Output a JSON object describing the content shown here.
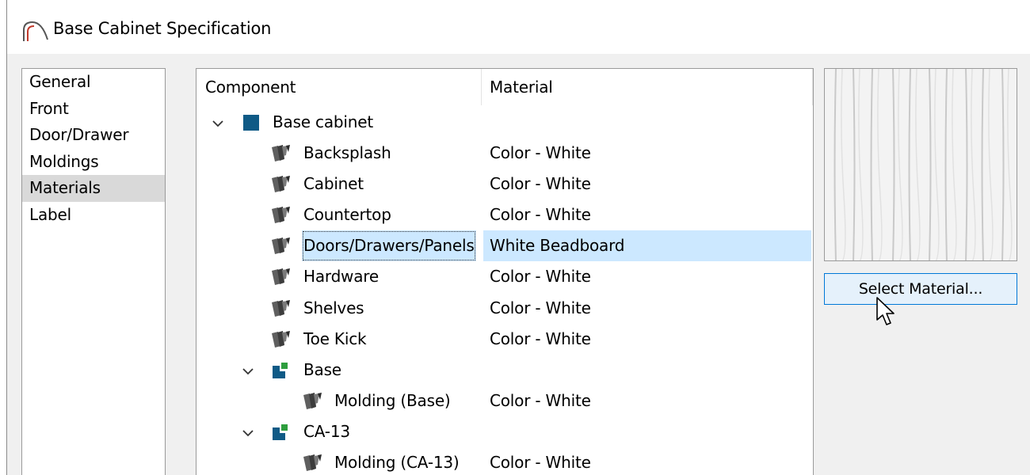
{
  "window": {
    "title": "Base Cabinet Specification",
    "icon": "arc-app-icon"
  },
  "nav": {
    "items": [
      {
        "label": "General",
        "selected": false
      },
      {
        "label": "Front",
        "selected": false
      },
      {
        "label": "Door/Drawer",
        "selected": false
      },
      {
        "label": "Moldings",
        "selected": false
      },
      {
        "label": "Materials",
        "selected": true
      },
      {
        "label": "Label",
        "selected": false
      }
    ]
  },
  "tree": {
    "columns": {
      "component": "Component",
      "material": "Material"
    },
    "rows": [
      {
        "name": "Base cabinet",
        "material": "",
        "icon": "blue-square-icon",
        "level": 0,
        "expandable": true
      },
      {
        "name": "Backsplash",
        "material": "Color - White",
        "icon": "material-swatch-icon",
        "level": 1,
        "expandable": false
      },
      {
        "name": "Cabinet",
        "material": "Color - White",
        "icon": "material-swatch-icon",
        "level": 1,
        "expandable": false
      },
      {
        "name": "Countertop",
        "material": "Color - White",
        "icon": "material-swatch-icon",
        "level": 1,
        "expandable": false
      },
      {
        "name": "Doors/Drawers/Panels",
        "material": "White Beadboard",
        "icon": "material-swatch-icon",
        "level": 1,
        "expandable": false,
        "selected": true
      },
      {
        "name": "Hardware",
        "material": "Color - White",
        "icon": "material-swatch-icon",
        "level": 1,
        "expandable": false
      },
      {
        "name": "Shelves",
        "material": "Color - White",
        "icon": "material-swatch-icon",
        "level": 1,
        "expandable": false
      },
      {
        "name": "Toe Kick",
        "material": "Color - White",
        "icon": "material-swatch-icon",
        "level": 1,
        "expandable": false
      },
      {
        "name": "Base",
        "material": "",
        "icon": "molding-profile-icon",
        "level": 1,
        "expandable": true
      },
      {
        "name": "Molding (Base)",
        "material": "Color - White",
        "icon": "material-swatch-icon",
        "level": 2,
        "expandable": false
      },
      {
        "name": "CA-13",
        "material": "",
        "icon": "molding-profile-icon",
        "level": 1,
        "expandable": true
      },
      {
        "name": "Molding (CA-13)",
        "material": "Color - White",
        "icon": "material-swatch-icon",
        "level": 2,
        "expandable": false
      }
    ]
  },
  "preview": {
    "material": "White Beadboard"
  },
  "select_button": {
    "label": "Select Material..."
  },
  "colors": {
    "selection": "#cce8ff",
    "nav_selection": "#d9d9d9",
    "button_border": "#0078d7",
    "button_fill": "#e5f1fb",
    "node_blue": "#0f5a86",
    "node_green": "#2e9e3e"
  }
}
